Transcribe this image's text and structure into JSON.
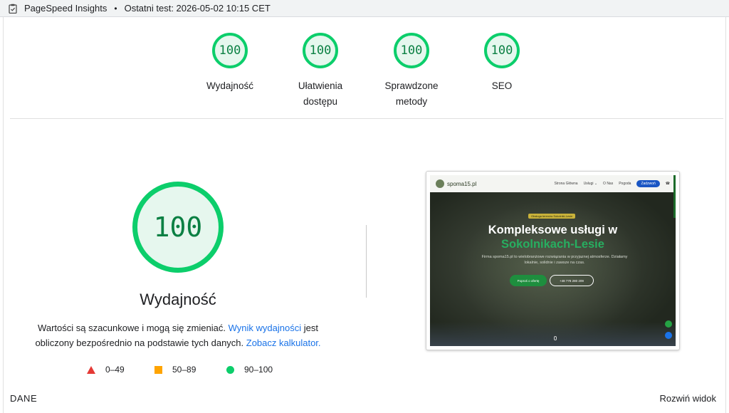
{
  "topbar": {
    "app_name": "PageSpeed Insights",
    "separator": "•",
    "last_test": "Ostatni test: 2026-05-02 10:15 CET"
  },
  "categories": [
    {
      "score": "100",
      "label_line1": "Wydajność",
      "label_line2": ""
    },
    {
      "score": "100",
      "label_line1": "Ułatwienia",
      "label_line2": "dostępu"
    },
    {
      "score": "100",
      "label_line1": "Sprawdzone",
      "label_line2": "metody"
    },
    {
      "score": "100",
      "label_line1": "SEO",
      "label_line2": ""
    }
  ],
  "main": {
    "score": "100",
    "title": "Wydajność",
    "desc_part1": "Wartości są szacunkowe i mogą się zmieniać. ",
    "desc_link1": "Wynik wydajności",
    "desc_part2": " jest obliczony bezpośrednio na podstawie tych danych. ",
    "desc_link2": "Zobacz kalkulator."
  },
  "legend": [
    {
      "symbol": "triangle",
      "range": "0–49",
      "color": "#e53935"
    },
    {
      "symbol": "square",
      "range": "50–89",
      "color": "#ffa400"
    },
    {
      "symbol": "circle",
      "range": "90–100",
      "color": "#0cce6b"
    }
  ],
  "screenshot": {
    "brand": "spoma15.pl",
    "menu": [
      "Strona Główna",
      "Usługi ⌄",
      "O Nas",
      "Pogoda"
    ],
    "menu_button": "Zadzwoń",
    "badge": "Obsługa terenów Sokolniki-Lesie",
    "heading_line1": "Kompleksowe usługi w",
    "heading_line2": "Sokolnikach-Lesie",
    "paragraph": "Firma spoma15.pl to wielobranżowe rozwiązania w przyjaznej atmosferze. Działamy lokalnie, solidnie i zawsze na czas.",
    "cta_primary": "Poproś o ofertę",
    "cta_secondary": "+48 778 280 209"
  },
  "footer": {
    "left": "DANE",
    "right": "Rozwiń widok"
  },
  "colors": {
    "pass": "#0cce6b",
    "pass_text": "#0b8043",
    "link": "#1a73e8"
  }
}
